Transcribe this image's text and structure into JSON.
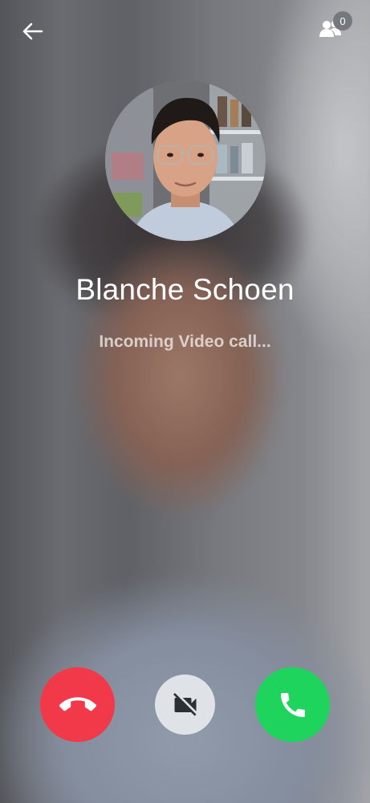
{
  "header": {
    "back_icon": "arrow-left-icon",
    "participants_icon": "people-icon",
    "participants_count": "0"
  },
  "caller": {
    "name": "Blanche Schoen",
    "status": "Incoming Video call..."
  },
  "actions": {
    "decline_icon": "phone-hangup-icon",
    "decline_color": "#f2394a",
    "video_icon": "video-off-icon",
    "video_color": "#dfe3e8",
    "accept_icon": "phone-icon",
    "accept_color": "#1fd45c"
  }
}
